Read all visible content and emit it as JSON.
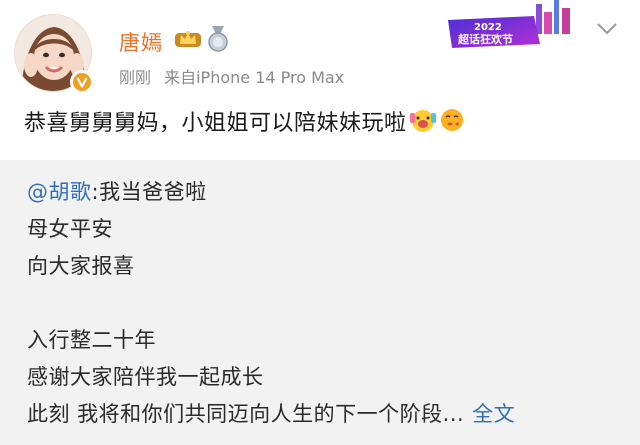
{
  "post": {
    "username": "唐嫣",
    "time": "刚刚",
    "source": "来自iPhone 14 Pro Max",
    "text": "恭喜舅舅舅妈，小姐姐可以陪妹妹玩啦",
    "banner_text": "2022 超话狂欢节"
  },
  "repost": {
    "author": "@胡歌",
    "first_line": ":我当爸爸啦",
    "lines": [
      "母女平安",
      "向大家报喜",
      "",
      "入行整二十年",
      "感谢大家陪伴我一起成长"
    ],
    "last_line": "此刻 我将和你们共同迈向人生的下一个阶段...",
    "expand_label": "全文"
  },
  "colors": {
    "username": "#e8732a",
    "link": "#2f6fb8",
    "meta": "#8a8a8a",
    "repost_bg": "#f2f2f2"
  }
}
